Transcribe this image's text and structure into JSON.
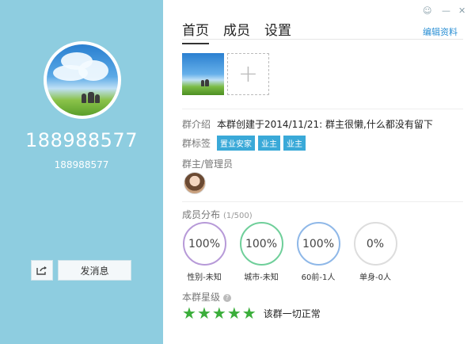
{
  "profile": {
    "group_number": "188988577",
    "group_sub_number": "188988577",
    "send_button": "发消息"
  },
  "tabs": [
    {
      "label": "首页"
    },
    {
      "label": "成员"
    },
    {
      "label": "设置"
    }
  ],
  "edit_link": "编辑资料",
  "intro": {
    "label": "群介绍",
    "text": "本群创建于2014/11/21: 群主很懒,什么都没有留下"
  },
  "tags": {
    "label": "群标签",
    "items": [
      "置业安家",
      "业主",
      "业主"
    ]
  },
  "admins": {
    "title": "群主/管理员"
  },
  "members": {
    "title": "成员分布",
    "count": "(1/500)",
    "stats": [
      {
        "value": "100%",
        "label": "性别-未知",
        "color": "#b79ad8"
      },
      {
        "value": "100%",
        "label": "城市-未知",
        "color": "#6fcf9a"
      },
      {
        "value": "100%",
        "label": "60前-1人",
        "color": "#8fb8e8"
      },
      {
        "value": "0%",
        "label": "单身-0人",
        "color": "#dddddd"
      }
    ]
  },
  "rating": {
    "title": "本群星级",
    "stars": 5,
    "text": "该群一切正常"
  },
  "colors": {
    "left_panel": "#8ecde0",
    "accent": "#3aa9d8",
    "star": "#3aae3a"
  }
}
